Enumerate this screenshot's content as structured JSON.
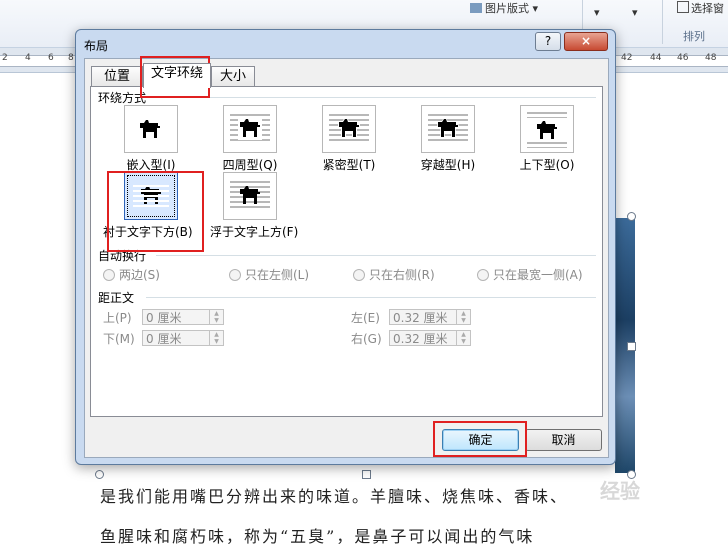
{
  "ribbon": {
    "picture_format_label": "图片版式",
    "select_label": "选择窗",
    "group_label": "排列"
  },
  "ruler": {
    "left_numbers": [
      "2",
      "4",
      "6",
      "8"
    ],
    "right_numbers": [
      "42",
      "44",
      "46",
      "48"
    ]
  },
  "dialog": {
    "title": "布局",
    "help_button": "?",
    "close_button": "×",
    "tabs": [
      {
        "label": "位置",
        "active": false
      },
      {
        "label": "文字环绕",
        "active": true
      },
      {
        "label": "大小",
        "active": false
      }
    ],
    "wrap_section_label": "环绕方式",
    "wrap_styles": [
      {
        "label": "嵌入型(I)",
        "icon": "dog-inline-icon",
        "selected": false
      },
      {
        "label": "四周型(Q)",
        "icon": "dog-square-icon",
        "selected": false
      },
      {
        "label": "紧密型(T)",
        "icon": "dog-tight-icon",
        "selected": false
      },
      {
        "label": "穿越型(H)",
        "icon": "dog-through-icon",
        "selected": false
      },
      {
        "label": "上下型(O)",
        "icon": "dog-topbottom-icon",
        "selected": false
      },
      {
        "label": "衬于文字下方(B)",
        "icon": "dog-behind-text-icon",
        "selected": true
      },
      {
        "label": "浮于文字上方(F)",
        "icon": "dog-infront-text-icon",
        "selected": false
      }
    ],
    "autowrap_section_label": "自动换行",
    "autowrap_options": [
      "两边(S)",
      "只在左侧(L)",
      "只在右侧(R)",
      "只在最宽一侧(A)"
    ],
    "distance_section_label": "距正文",
    "distance": {
      "top_label": "上(P)",
      "top_value": "0 厘米",
      "bottom_label": "下(M)",
      "bottom_value": "0 厘米",
      "left_label": "左(E)",
      "left_value": "0.32 厘米",
      "right_label": "右(G)",
      "right_value": "0.32 厘米"
    },
    "ok_button": "确定",
    "cancel_button": "取消"
  },
  "document": {
    "line1": "是我们能用嘴巴分辨出来的味道。羊膻味、烧焦味、香味、",
    "line2": "鱼腥味和腐朽味，称为“五臭”，是鼻子可以闻出的气味"
  },
  "watermark": "经验",
  "colors": {
    "highlight_red": "#e02020",
    "dialog_frame": "#c9daf0",
    "default_button": "#bee6fd"
  }
}
